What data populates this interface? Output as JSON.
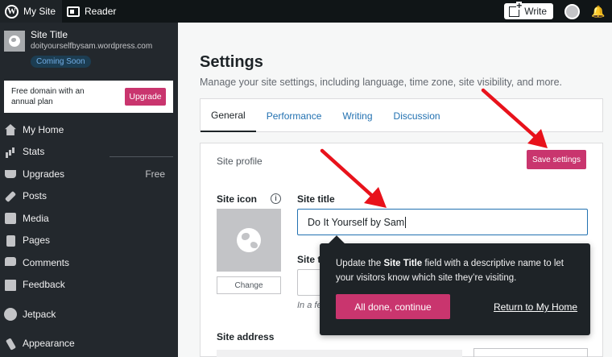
{
  "masterbar": {
    "my_site_label": "My Site",
    "reader_label": "Reader",
    "write_label": "Write"
  },
  "site": {
    "title": "Site Title",
    "url": "doityourselfbysam.wordpress.com",
    "status_badge": "Coming Soon"
  },
  "domain_card": {
    "text_line1": "Free domain with an",
    "text_line2": "annual plan",
    "upgrade_label": "Upgrade"
  },
  "sidebar": {
    "items": [
      {
        "label": "My Home",
        "icon": "house-icon"
      },
      {
        "label": "Stats",
        "icon": "bar-chart-icon"
      },
      {
        "label": "Upgrades",
        "icon": "cart-icon",
        "badge": "Free"
      },
      {
        "label": "Posts",
        "icon": "pushpin-icon"
      },
      {
        "label": "Media",
        "icon": "media-icon"
      },
      {
        "label": "Pages",
        "icon": "pages-icon"
      },
      {
        "label": "Comments",
        "icon": "comment-bubble-icon"
      },
      {
        "label": "Feedback",
        "icon": "feedback-icon"
      },
      {
        "label": "Jetpack",
        "icon": "jetpack-icon"
      },
      {
        "label": "Appearance",
        "icon": "brush-icon"
      }
    ]
  },
  "page": {
    "title": "Settings",
    "subtitle": "Manage your site settings, including language, time zone, site visibility, and more."
  },
  "tabs": [
    {
      "label": "General",
      "active": true
    },
    {
      "label": "Performance"
    },
    {
      "label": "Writing"
    },
    {
      "label": "Discussion"
    }
  ],
  "site_profile": {
    "header_label": "Site profile",
    "save_label": "Save settings",
    "site_icon_label": "Site icon",
    "change_label": "Change",
    "site_title_label": "Site title",
    "site_title_value": "Do It Yourself by Sam",
    "tagline_label_fragment": "Site t",
    "hint_fragment": "In a fe",
    "site_address_label": "Site address"
  },
  "tooltip": {
    "text_before": "Update the ",
    "text_bold": "Site Title",
    "text_after": " field with a descriptive name to let your visitors know which site they’re visiting.",
    "primary_label": "All done, continue",
    "link_label": "Return to My Home"
  },
  "colors": {
    "accent_pink": "#c9356e",
    "link_blue": "#2271b1",
    "sidebar_bg": "#23282d",
    "arrow_red": "#e8121b"
  }
}
